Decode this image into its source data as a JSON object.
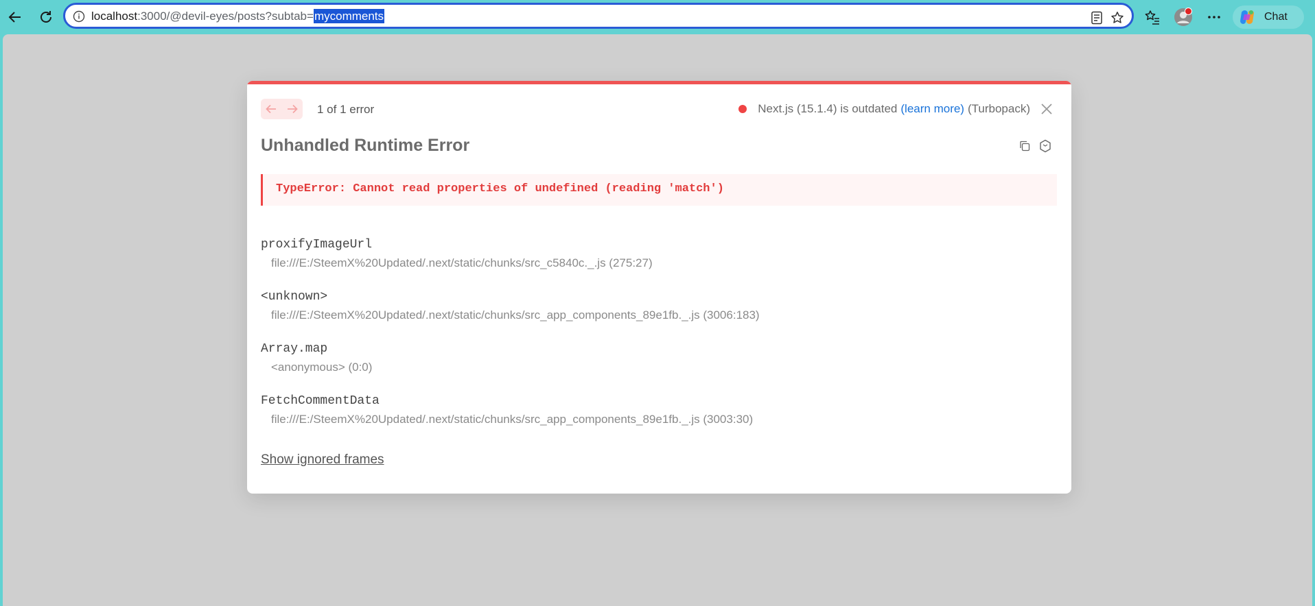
{
  "browser": {
    "url_prefix": "localhost",
    "url_rest": ":3000/@devil-eyes/posts?subtab=",
    "url_selected": "mycomments",
    "chat_label": "Chat",
    "icons": [
      "back-arrow-icon",
      "refresh-icon",
      "info-icon",
      "reader-mode-icon",
      "favorite-star-icon",
      "favorites-list-icon",
      "profile-avatar-icon",
      "more-menu-icon",
      "copilot-icon"
    ],
    "accent_color": "#62d2d2",
    "selection_color": "#1a56d6"
  },
  "error_overlay": {
    "count_label": "1 of 1 error",
    "version_text": "Next.js (15.1.4) is outdated",
    "learn_more": "(learn more)",
    "bundler": "(Turbopack)",
    "title": "Unhandled Runtime Error",
    "message": "TypeError: Cannot read properties of undefined (reading 'match')",
    "frames": [
      {
        "fn": "proxifyImageUrl",
        "location": "file:///E:/SteemX%20Updated/.next/static/chunks/src_c5840c._.js (275:27)"
      },
      {
        "fn": "<unknown>",
        "location": "file:///E:/SteemX%20Updated/.next/static/chunks/src_app_components_89e1fb._.js (3006:183)"
      },
      {
        "fn": "Array.map",
        "location": "<anonymous> (0:0)"
      },
      {
        "fn": "FetchCommentData",
        "location": "file:///E:/SteemX%20Updated/.next/static/chunks/src_app_components_89e1fb._.js (3003:30)"
      }
    ],
    "show_ignored": "Show ignored frames",
    "error_color": "#ef4444",
    "link_color": "#1a73d9"
  }
}
